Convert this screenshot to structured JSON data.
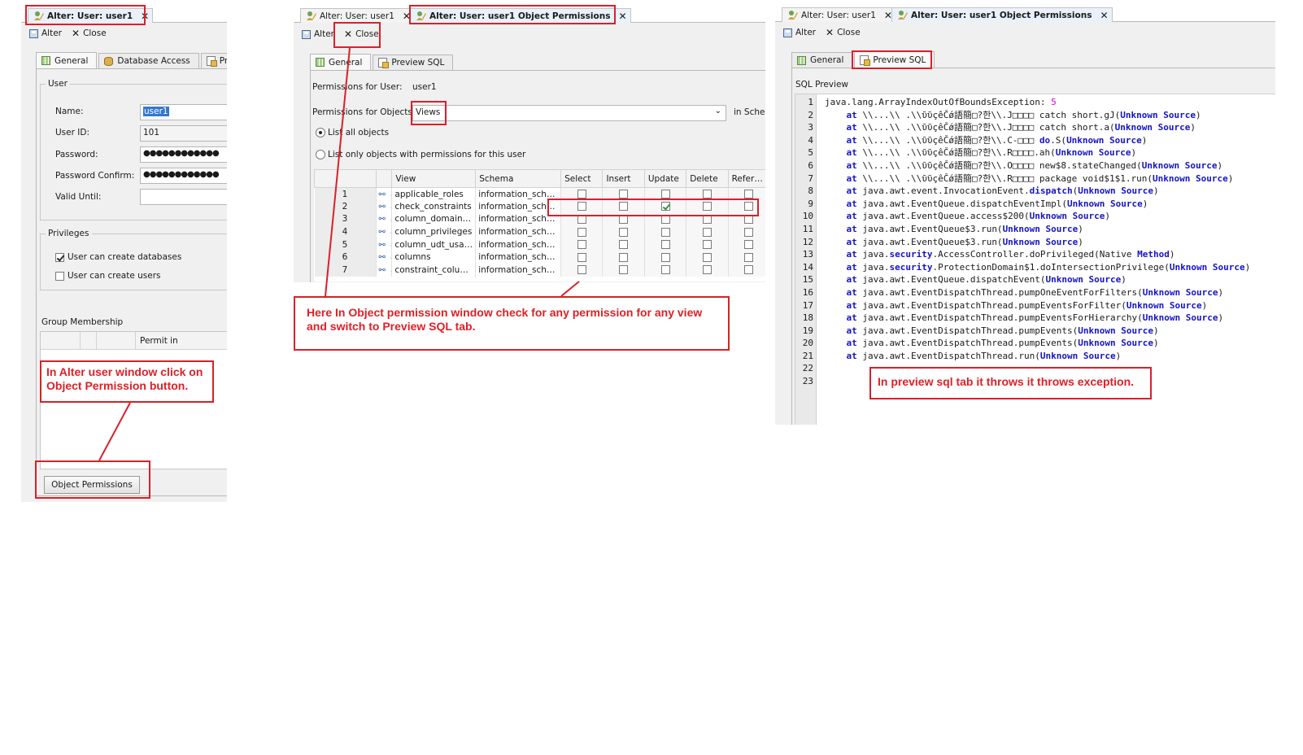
{
  "panel1": {
    "tab_title": "Alter: User: user1",
    "tab_close": "✕",
    "toolbar": {
      "alter": "Alter",
      "close": "Close"
    },
    "tabs": [
      "General",
      "Database Access",
      "Pre"
    ],
    "user_group": "User",
    "fields": {
      "name_label": "Name:",
      "name_value": "user1",
      "userid_label": "User ID:",
      "userid_value": "101",
      "password_label": "Password:",
      "password_value": "●●●●●●●●●●●●",
      "confirm_label": "Password Confirm:",
      "confirm_value": "●●●●●●●●●●●●",
      "valid_label": "Valid Until:",
      "valid_value": ""
    },
    "privileges_group": "Privileges",
    "privileges": [
      {
        "label": "User can create databases",
        "checked": true
      },
      {
        "label": "User can create users",
        "checked": false
      }
    ],
    "group_membership": "Group Membership",
    "gm_column": "Permit in",
    "object_permissions_button": "Object Permissions"
  },
  "panel2": {
    "tabs_top": [
      {
        "label": "Alter: User: user1",
        "close": "✕"
      },
      {
        "label": "Alter: User: user1 Object Permissions",
        "close": "✕"
      }
    ],
    "toolbar": {
      "alter": "Alter",
      "close": "Close"
    },
    "tabs": [
      "General",
      "Preview SQL"
    ],
    "perm_user_label": "Permissions for User:",
    "perm_user_value": "user1",
    "perm_objects_label": "Permissions for Objects:",
    "perm_objects_value": "Views",
    "in_schema": "in Schem",
    "radio_all": "List all objects",
    "radio_only": "List only objects with permissions for this user",
    "columns": [
      "",
      "",
      "View",
      "Schema",
      "Select",
      "Insert",
      "Update",
      "Delete",
      "Refer…"
    ],
    "rows": [
      {
        "n": "1",
        "view": "applicable_roles",
        "schema": "information_schema",
        "perms": [
          false,
          false,
          false,
          false,
          false
        ]
      },
      {
        "n": "2",
        "view": "check_constraints",
        "schema": "information_schema",
        "perms": [
          false,
          false,
          true,
          false,
          false
        ]
      },
      {
        "n": "3",
        "view": "column_domain_u…",
        "schema": "information_schema",
        "perms": [
          false,
          false,
          false,
          false,
          false
        ]
      },
      {
        "n": "4",
        "view": "column_privileges",
        "schema": "information_schema",
        "perms": [
          false,
          false,
          false,
          false,
          false
        ]
      },
      {
        "n": "5",
        "view": "column_udt_usage",
        "schema": "information_schema",
        "perms": [
          false,
          false,
          false,
          false,
          false
        ]
      },
      {
        "n": "6",
        "view": "columns",
        "schema": "information_schema",
        "perms": [
          false,
          false,
          false,
          false,
          false
        ]
      },
      {
        "n": "7",
        "view": "constraint_colum…",
        "schema": "information_schema",
        "perms": [
          false,
          false,
          false,
          false,
          false
        ]
      }
    ]
  },
  "panel3": {
    "tabs_top": [
      {
        "label": "Alter: User: user1",
        "close": "✕"
      },
      {
        "label": "Alter: User: user1 Object Permissions",
        "close": "✕"
      }
    ],
    "toolbar": {
      "alter": "Alter",
      "close": "Close"
    },
    "tabs": [
      "General",
      "Preview SQL"
    ],
    "sql_preview_label": "SQL Preview",
    "line_numbers": [
      "1",
      "2",
      "3",
      "4",
      "5",
      "6",
      "7",
      "8",
      "9",
      "10",
      "11",
      "12",
      "13",
      "14",
      "15",
      "16",
      "17",
      "18",
      "19",
      "20",
      "21",
      "22",
      "23"
    ],
    "lines": [
      [
        [
          "",
          "java.lang.ArrayIndexOutOfBoundsException: "
        ],
        [
          "num",
          "5"
        ]
      ],
      [
        [
          "",
          "    "
        ],
        [
          "kw",
          "at"
        ],
        [
          "",
          " \\\\...\\\\ .\\\\ῦῦçêČǿ語簡□?한\\\\.J□□□□ catch short.gJ("
        ],
        [
          "kw",
          "Unknown Source"
        ],
        [
          "",
          ")"
        ]
      ],
      [
        [
          "",
          "    "
        ],
        [
          "kw",
          "at"
        ],
        [
          "",
          " \\\\...\\\\ .\\\\ῦῦçêČǿ語簡□?한\\\\.J□□□□ catch short.a("
        ],
        [
          "kw",
          "Unknown Source"
        ],
        [
          "",
          ")"
        ]
      ],
      [
        [
          "",
          "    "
        ],
        [
          "kw",
          "at"
        ],
        [
          "",
          " \\\\...\\\\ .\\\\ῦῦçêČǿ語簡□?한\\\\.C-□□□ "
        ],
        [
          "kw",
          "do"
        ],
        [
          "",
          ".S("
        ],
        [
          "kw",
          "Unknown Source"
        ],
        [
          "",
          ")"
        ]
      ],
      [
        [
          "",
          "    "
        ],
        [
          "kw",
          "at"
        ],
        [
          "",
          " \\\\...\\\\ .\\\\ῦῦçêČǿ語簡□?한\\\\.R□□□□.ah("
        ],
        [
          "kw",
          "Unknown Source"
        ],
        [
          "",
          ")"
        ]
      ],
      [
        [
          "",
          "    "
        ],
        [
          "kw",
          "at"
        ],
        [
          "",
          " \\\\...\\\\ .\\\\ῦῦçêČǿ語簡□?한\\\\.O□□□□ new$8.stateChanged("
        ],
        [
          "kw",
          "Unknown Source"
        ],
        [
          "",
          ")"
        ]
      ],
      [
        [
          "",
          "    "
        ],
        [
          "kw",
          "at"
        ],
        [
          "",
          " \\\\...\\\\ .\\\\ῦῦçêČǿ語簡□?한\\\\.R□□□□ package void$1$1.run("
        ],
        [
          "kw",
          "Unknown Source"
        ],
        [
          "",
          ")"
        ]
      ],
      [
        [
          "",
          "    "
        ],
        [
          "kw",
          "at"
        ],
        [
          "",
          " java.awt.event.InvocationEvent."
        ],
        [
          "kw",
          "dispatch"
        ],
        [
          "",
          "("
        ],
        [
          "kw",
          "Unknown Source"
        ],
        [
          "",
          ")"
        ]
      ],
      [
        [
          "",
          "    "
        ],
        [
          "kw",
          "at"
        ],
        [
          "",
          " java.awt.EventQueue.dispatchEventImpl("
        ],
        [
          "kw",
          "Unknown Source"
        ],
        [
          "",
          ")"
        ]
      ],
      [
        [
          "",
          "    "
        ],
        [
          "kw",
          "at"
        ],
        [
          "",
          " java.awt.EventQueue.access$200("
        ],
        [
          "kw",
          "Unknown Source"
        ],
        [
          "",
          ")"
        ]
      ],
      [
        [
          "",
          "    "
        ],
        [
          "kw",
          "at"
        ],
        [
          "",
          " java.awt.EventQueue$3.run("
        ],
        [
          "kw",
          "Unknown Source"
        ],
        [
          "",
          ")"
        ]
      ],
      [
        [
          "",
          "    "
        ],
        [
          "kw",
          "at"
        ],
        [
          "",
          " java.awt.EventQueue$3.run("
        ],
        [
          "kw",
          "Unknown Source"
        ],
        [
          "",
          ")"
        ]
      ],
      [
        [
          "",
          "    "
        ],
        [
          "kw",
          "at"
        ],
        [
          "",
          " java."
        ],
        [
          "kw",
          "security"
        ],
        [
          "",
          ".AccessController.doPrivileged(Native "
        ],
        [
          "kw",
          "Method"
        ],
        [
          "",
          ")"
        ]
      ],
      [
        [
          "",
          "    "
        ],
        [
          "kw",
          "at"
        ],
        [
          "",
          " java."
        ],
        [
          "kw",
          "security"
        ],
        [
          "",
          ".ProtectionDomain$1.doIntersectionPrivilege("
        ],
        [
          "kw",
          "Unknown Source"
        ],
        [
          "",
          ")"
        ]
      ],
      [
        [
          "",
          "    "
        ],
        [
          "kw",
          "at"
        ],
        [
          "",
          " java.awt.EventQueue.dispatchEvent("
        ],
        [
          "kw",
          "Unknown Source"
        ],
        [
          "",
          ")"
        ]
      ],
      [
        [
          "",
          "    "
        ],
        [
          "kw",
          "at"
        ],
        [
          "",
          " java.awt.EventDispatchThread.pumpOneEventForFilters("
        ],
        [
          "kw",
          "Unknown Source"
        ],
        [
          "",
          ")"
        ]
      ],
      [
        [
          "",
          "    "
        ],
        [
          "kw",
          "at"
        ],
        [
          "",
          " java.awt.EventDispatchThread.pumpEventsForFilter("
        ],
        [
          "kw",
          "Unknown Source"
        ],
        [
          "",
          ")"
        ]
      ],
      [
        [
          "",
          "    "
        ],
        [
          "kw",
          "at"
        ],
        [
          "",
          " java.awt.EventDispatchThread.pumpEventsForHierarchy("
        ],
        [
          "kw",
          "Unknown Source"
        ],
        [
          "",
          ")"
        ]
      ],
      [
        [
          "",
          "    "
        ],
        [
          "kw",
          "at"
        ],
        [
          "",
          " java.awt.EventDispatchThread.pumpEvents("
        ],
        [
          "kw",
          "Unknown Source"
        ],
        [
          "",
          ")"
        ]
      ],
      [
        [
          "",
          "    "
        ],
        [
          "kw",
          "at"
        ],
        [
          "",
          " java.awt.EventDispatchThread.pumpEvents("
        ],
        [
          "kw",
          "Unknown Source"
        ],
        [
          "",
          ")"
        ]
      ],
      [
        [
          "",
          "    "
        ],
        [
          "kw",
          "at"
        ],
        [
          "",
          " java.awt.EventDispatchThread.run("
        ],
        [
          "kw",
          "Unknown Source"
        ],
        [
          "",
          ")"
        ]
      ],
      [
        [
          "",
          ""
        ]
      ],
      [
        [
          "",
          ""
        ]
      ]
    ]
  },
  "annotations": {
    "callout1": "In Alter user window click on Object Permission button.",
    "callout2_line1": "Here In Object permission window check for any permission for any view",
    "callout2_line2": "and  switch to Preview SQL tab.",
    "callout3": "In preview sql tab it throws it throws exception."
  },
  "colors": {
    "annotation_red": "#d9202a",
    "keyword_blue": "#1414c8",
    "number_magenta": "#e100e1",
    "selection_blue": "#3478d1"
  }
}
